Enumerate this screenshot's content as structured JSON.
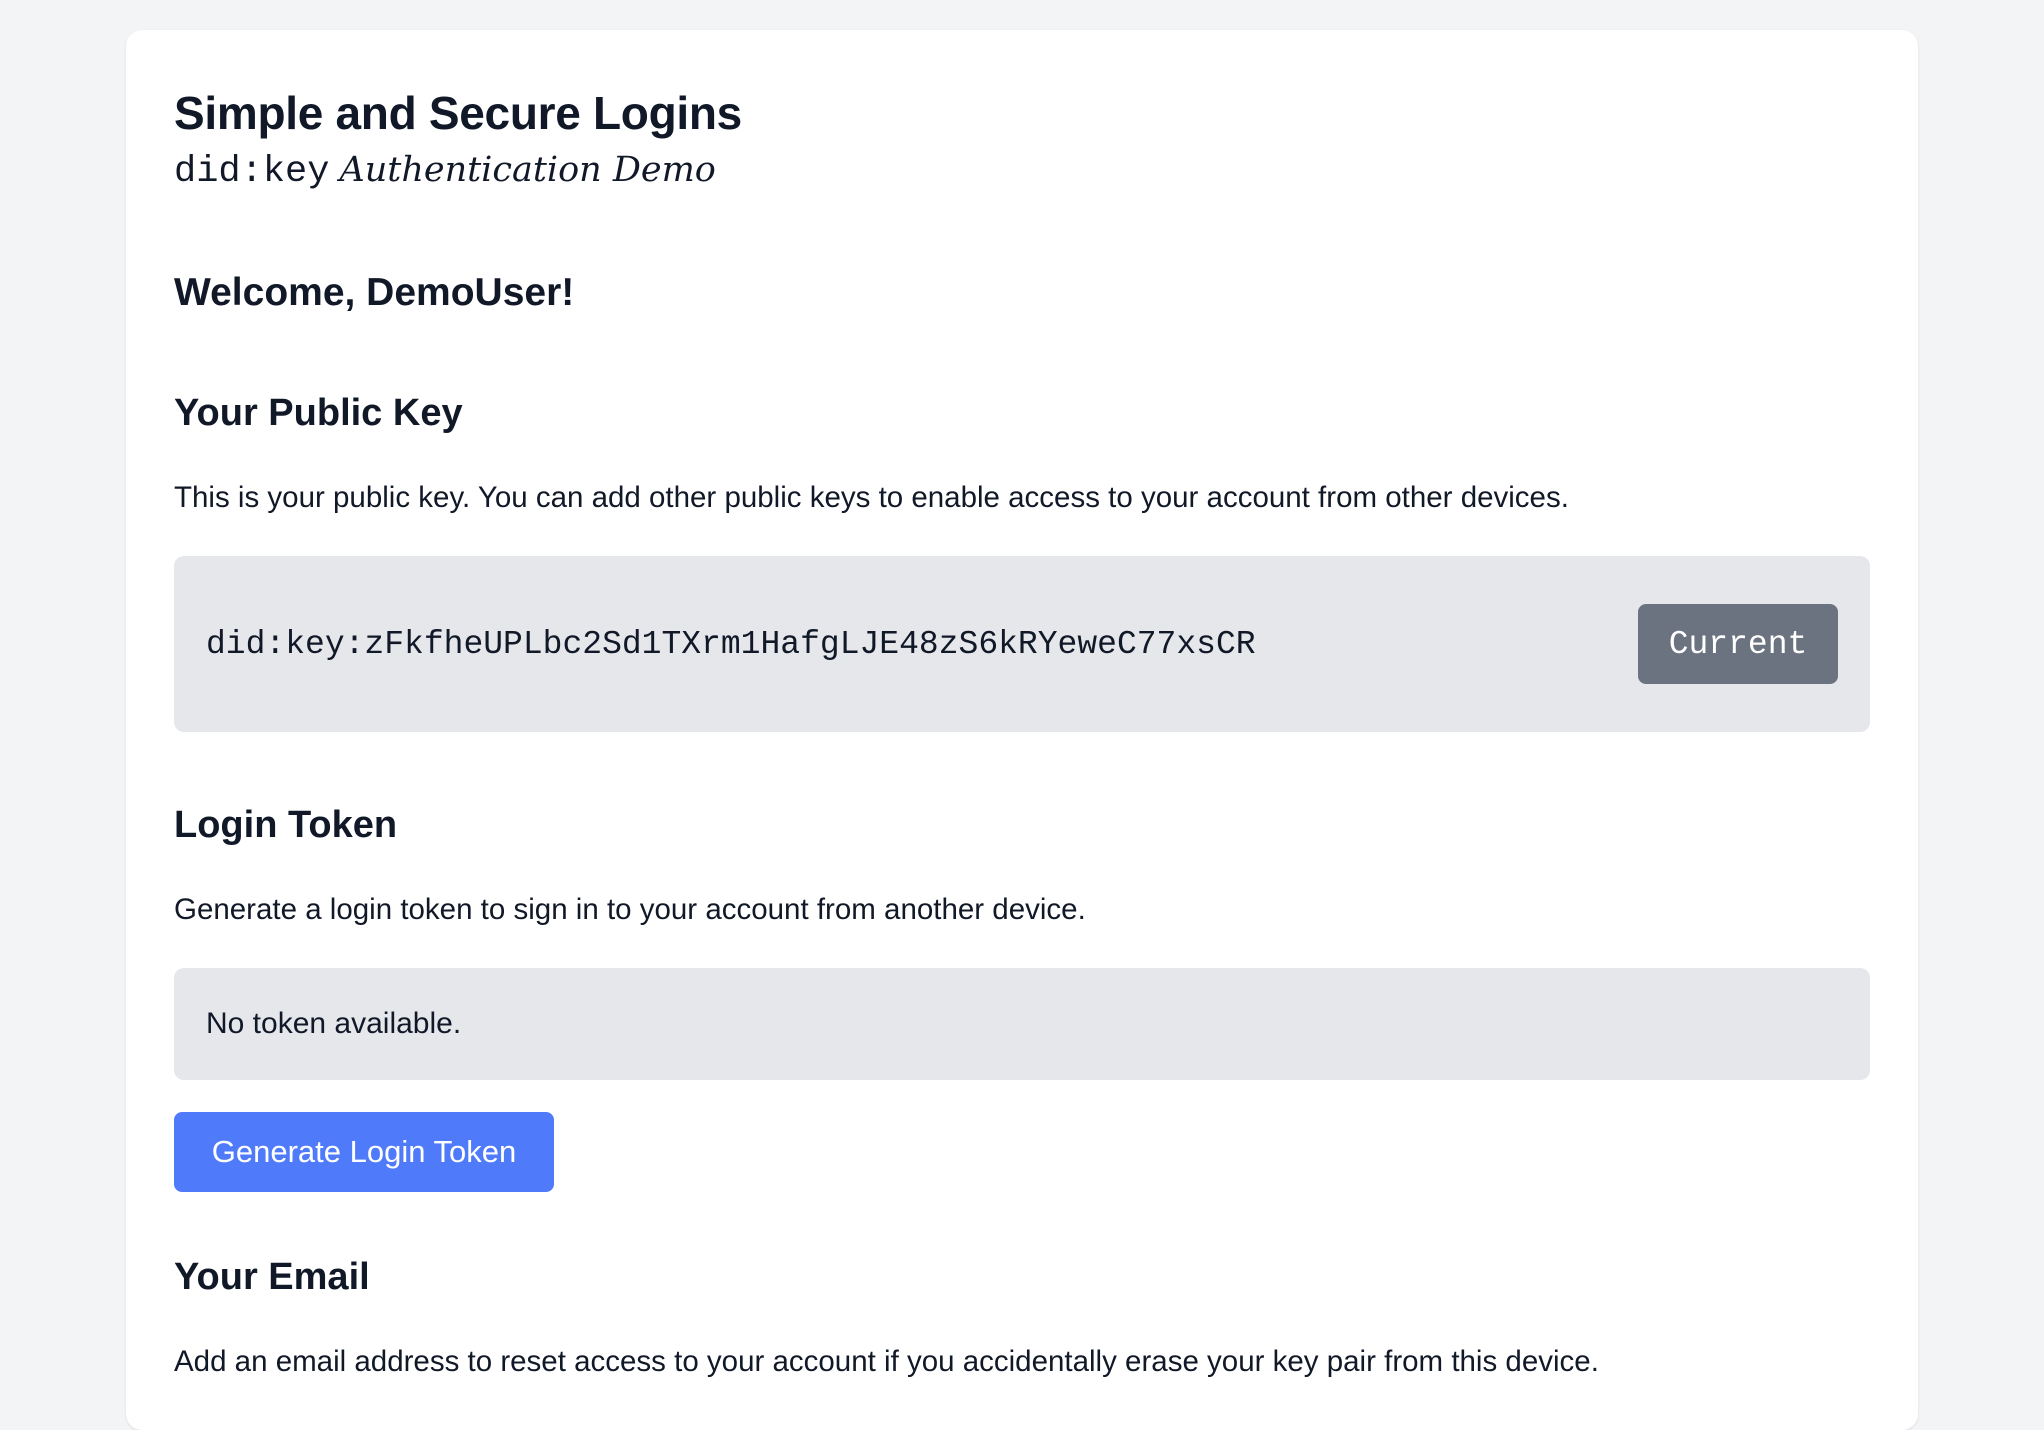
{
  "header": {
    "title": "Simple and Secure Logins",
    "subtitle_code": "did:key",
    "subtitle_text": "Authentication Demo"
  },
  "welcome": "Welcome, DemoUser!",
  "public_key": {
    "title": "Your Public Key",
    "description": "This is your public key. You can add other public keys to enable access to your account from other devices.",
    "key_value": "did:key:zFkfheUPLbc2Sd1TXrm1HafgLJE48zS6kRYeweC77xsCR",
    "badge_label": "Current"
  },
  "login_token": {
    "title": "Login Token",
    "description": "Generate a login token to sign in to your account from another device.",
    "status": "No token available.",
    "button_label": "Generate Login Token"
  },
  "email": {
    "title": "Your Email",
    "description": "Add an email address to reset access to your account if you accidentally erase your key pair from this device."
  },
  "colors": {
    "primary_button": "#4f7bfb",
    "current_badge": "#6b7280",
    "panel_background": "#e5e7eb",
    "page_background": "#f3f4f6"
  }
}
